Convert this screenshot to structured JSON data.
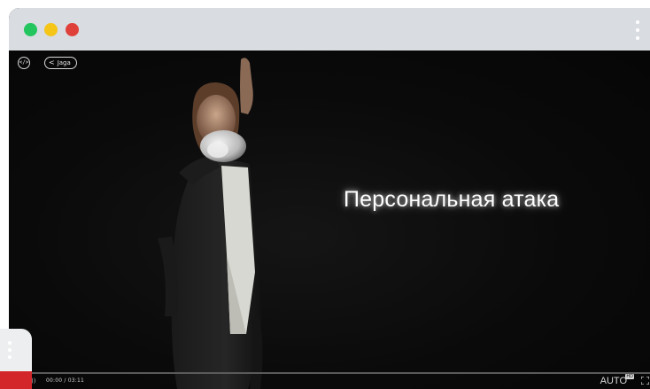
{
  "window": {
    "controls": {
      "green": "#22c55e",
      "yellow": "#f5c518",
      "red": "#e0403a"
    },
    "menu_icon": "kebab-menu-icon"
  },
  "player": {
    "embed_icon": "code-icon",
    "embed_label": "</>",
    "share_icon": "share-icon",
    "share_label": "Jaga",
    "caption": "Персональная атака",
    "time": "00:00 / 03:11",
    "quality": "AUTO",
    "quality_badge": "HD",
    "fullscreen_icon": "fullscreen-icon",
    "progress": 0
  },
  "widget": {
    "menu_icon": "kebab-menu-icon",
    "accent": "#d3262b"
  }
}
